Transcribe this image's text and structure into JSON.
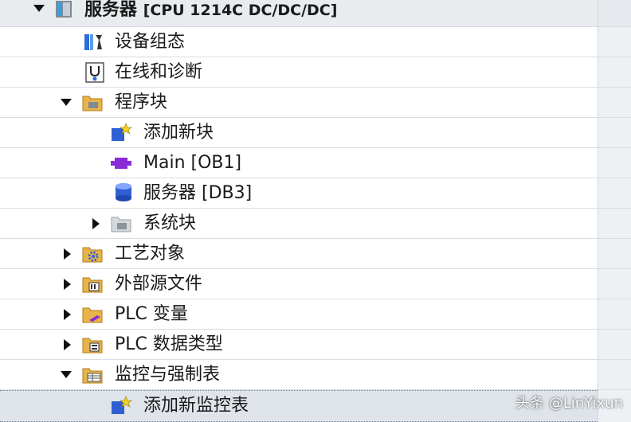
{
  "tree": {
    "root": {
      "name": "服务器",
      "device": "[CPU 1214C DC/DC/DC]"
    },
    "items": [
      {
        "label": "设备组态"
      },
      {
        "label": "在线和诊断"
      },
      {
        "label": "程序块"
      },
      {
        "label": "添加新块"
      },
      {
        "label": "Main [OB1]"
      },
      {
        "label": "服务器 [DB3]"
      },
      {
        "label": "系统块"
      },
      {
        "label": "工艺对象"
      },
      {
        "label": "外部源文件"
      },
      {
        "label": "PLC 变量"
      },
      {
        "label": "PLC 数据类型"
      },
      {
        "label": "监控与强制表"
      },
      {
        "label": "添加新监控表"
      }
    ]
  },
  "colors": {
    "folder": "#e8b44a",
    "block_blue": "#2f5fd0",
    "ob_purple": "#8a2bd6",
    "selection": "#dfe4ea"
  },
  "watermark": "头条 @LinYixun"
}
